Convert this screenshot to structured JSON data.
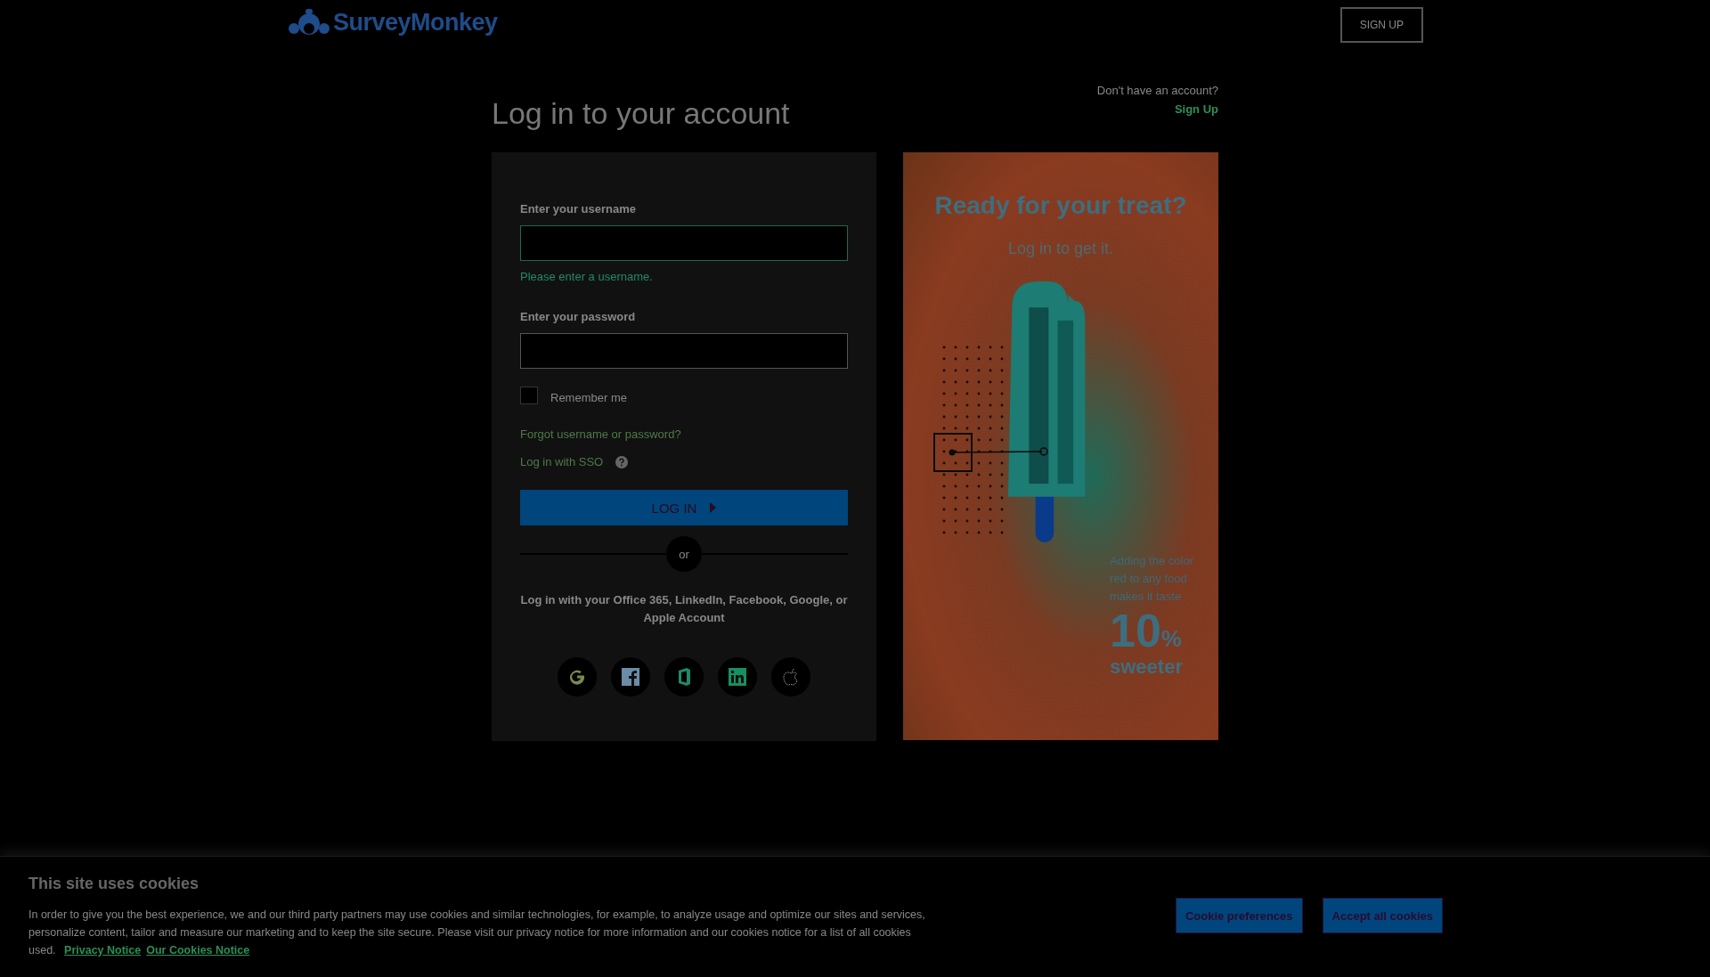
{
  "header": {
    "logo": "SurveyMonkey",
    "signup_button": "SIGN UP"
  },
  "title": "Log in to your account",
  "signup_prompt": {
    "text": "Don't have an account?",
    "link": "Sign Up"
  },
  "form": {
    "username": {
      "label": "Enter your username",
      "invalid": true,
      "error": "Please enter a username."
    },
    "password": {
      "label": "Enter your password",
      "invalid": false
    },
    "remember": {
      "label": "Remember me",
      "checked": false
    },
    "forgot_link": "Forgot username or password?",
    "sso_link": "Log in with SSO",
    "login_button": "LOG IN",
    "divider": "or",
    "social_text": "Log in with your Office 365, LinkedIn, Facebook, Google, or Apple Account",
    "social_buttons": [
      {
        "kind": "google"
      },
      {
        "kind": "facebook"
      },
      {
        "kind": "office"
      },
      {
        "kind": "linkedin"
      },
      {
        "kind": "apple"
      }
    ]
  },
  "promo": {
    "headline": "Ready for your treat?",
    "subline": "Log in to get it.",
    "fact": "Adding the color red to any food makes it taste",
    "big_number": "10",
    "percent": "%",
    "big_word": "sweeter"
  },
  "cookie_banner": {
    "title": "This site uses cookies",
    "text": "In order to give you the best experience, we and our third party partners may use cookies and similar technologies, for example, to analyze usage and optimize our sites and services, personalize content, tailor and measure our marketing and to keep the site secure. Please visit our privacy notice for more information and our cookies notice for a list of all cookies used.",
    "links": [
      "Privacy Notice",
      "Our Cookies Notice"
    ],
    "buttons": [
      "Cookie preferences",
      "Accept all cookies"
    ]
  }
}
